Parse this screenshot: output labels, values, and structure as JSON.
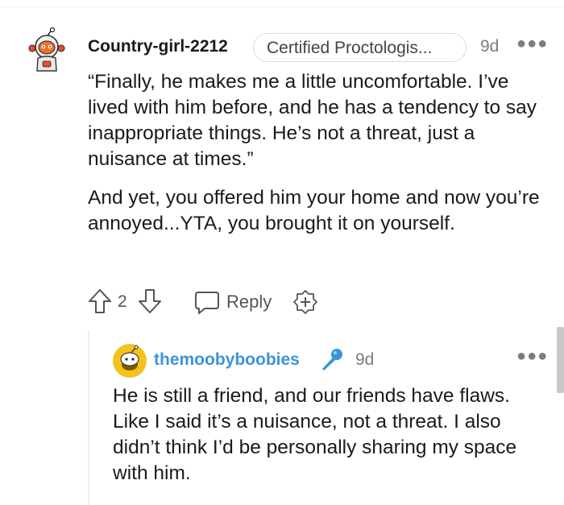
{
  "comment": {
    "username": "Country-girl-2212",
    "flair": "Certified Proctologis...",
    "age": "9d",
    "more_icon": "more-dots-icon",
    "paragraphs": [
      "“Finally, he makes me a little uncomfortable. I’ve lived with him before, and he has a tendency to say inappropriate things. He’s not a threat, just a nuisance at times.”",
      "And yet, you offered him your home and now you’re annoyed...YTA, you brought it on yourself."
    ],
    "score": "2",
    "reply_label": "Reply",
    "icons": {
      "upvote": "arrow-up-icon",
      "downvote": "arrow-down-icon",
      "reply": "speech-bubble-icon",
      "award": "award-plus-icon"
    }
  },
  "reply": {
    "username": "themoobyboobies",
    "badge_icon": "microphone-icon",
    "age": "9d",
    "body": "He is still a friend, and our friends have flaws. Like I said it’s a nuisance, not a threat. I also didn’t think I’d be personally sharing my space with him."
  },
  "colors": {
    "username_link": "#3b94d9",
    "meta": "#7c7c7c",
    "text": "#1a1a1b"
  }
}
